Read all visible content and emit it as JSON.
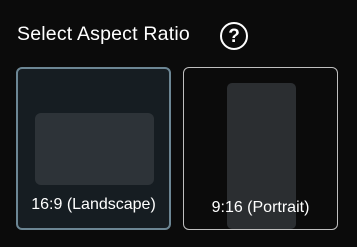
{
  "header": {
    "title": "Select Aspect Ratio",
    "help_icon": "question-circle-icon",
    "help_glyph": "?"
  },
  "options": [
    {
      "label": "16:9 (Landscape)",
      "selected": true
    },
    {
      "label": "9:16 (Portrait)",
      "selected": false
    }
  ],
  "colors": {
    "background": "#0b0b0b",
    "selected_border": "#6c8694",
    "unselected_border": "#bfbfbf",
    "preview_fill": "#2d3338"
  }
}
